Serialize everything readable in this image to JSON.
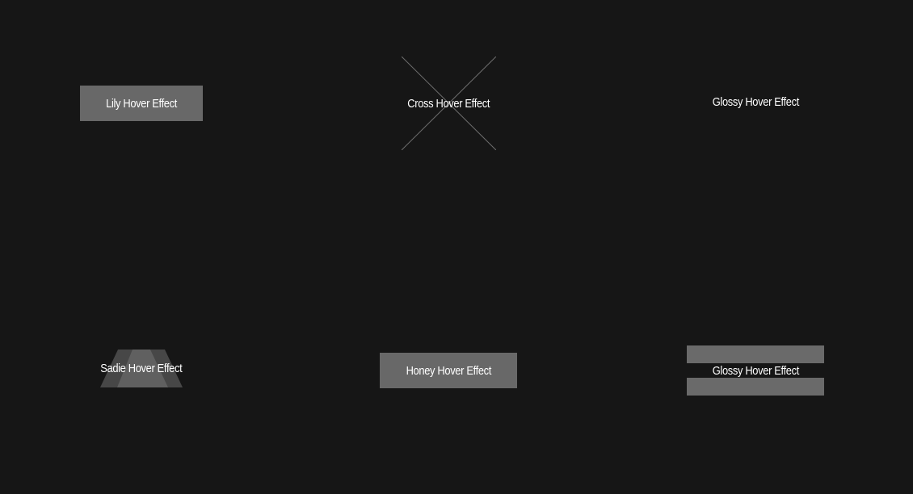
{
  "buttons": {
    "lily": {
      "label": "Lily Hover Effect"
    },
    "cross": {
      "label": "Cross Hover Effect"
    },
    "glossy_top": {
      "label": "Glossy Hover Effect"
    },
    "sadie": {
      "label": "Sadie Hover Effect"
    },
    "honey": {
      "label": "Honey Hover Effect"
    },
    "glossy_bottom": {
      "label": "Glossy Hover Effect"
    }
  },
  "colors": {
    "background": "#161616",
    "button_fill": "#686868",
    "text": "#ffffff",
    "cross_line": "#6e6e6e"
  }
}
